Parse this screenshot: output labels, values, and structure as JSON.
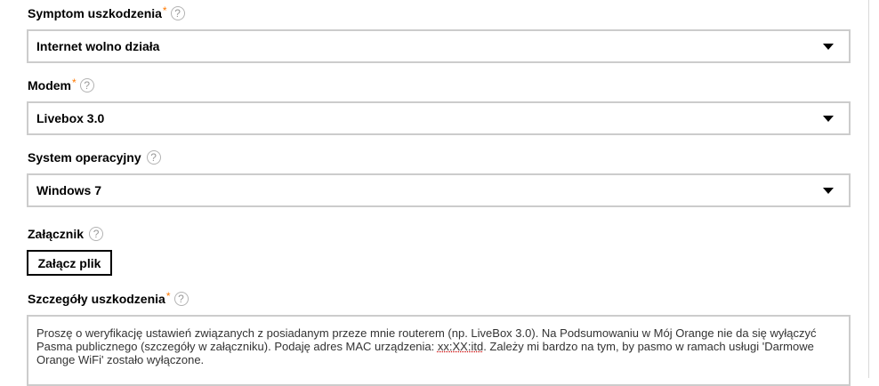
{
  "symptom": {
    "label": "Symptom uszkodzenia",
    "required_mark": "*",
    "help": "?",
    "value": "Internet wolno działa"
  },
  "modem": {
    "label": "Modem",
    "required_mark": "*",
    "help": "?",
    "value": "Livebox 3.0"
  },
  "os": {
    "label": "System operacyjny",
    "help": "?",
    "value": "Windows 7"
  },
  "attachment": {
    "label": "Załącznik",
    "help": "?",
    "button_label": "Załącz plik"
  },
  "details": {
    "label": "Szczegóły uszkodzenia",
    "required_mark": "*",
    "help": "?",
    "text_before_mac": "Proszę o weryfikację ustawień związanych z posiadanym przeze mnie routerem (np. LiveBox 3.0). Na Podsumowaniu w Mój Orange nie da się wyłączyć Pasma publicznego (szczegóły w załączniku). Podaję adres MAC urządzenia: ",
    "mac": "xx:XX:itd",
    "text_after_mac": ". Zależy mi bardzo na tym, by pasmo w ramach usługi 'Darmowe Orange WiFi' zostało wyłączone."
  },
  "colors": {
    "required": "#ff7900",
    "border": "#cccccc"
  }
}
